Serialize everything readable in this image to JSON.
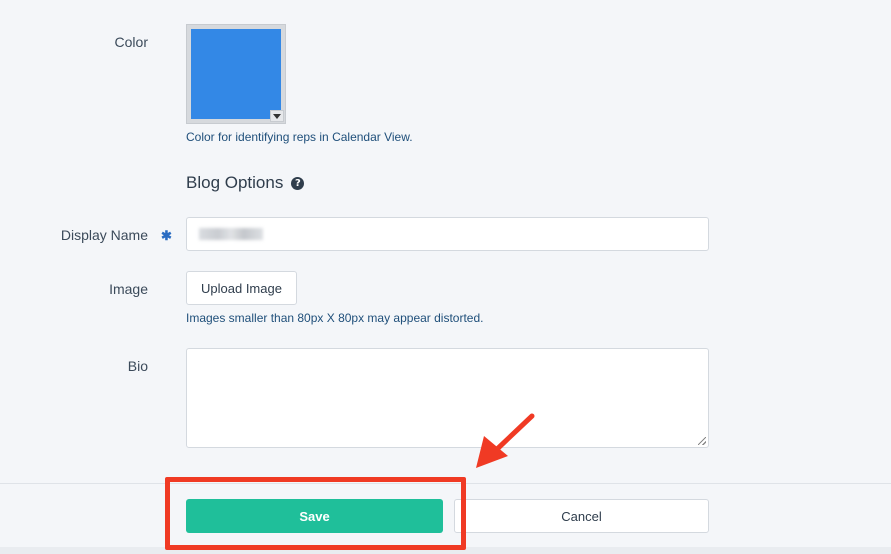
{
  "top_partial_text": "",
  "color_field": {
    "label": "Color",
    "value": "#3388e6",
    "help": "Color for identifying reps in Calendar View."
  },
  "blog_options": {
    "title": "Blog Options",
    "help_icon": "question-circle-icon"
  },
  "display_name": {
    "label": "Display Name",
    "required_mark": "✱",
    "value": ""
  },
  "image": {
    "label": "Image",
    "button_label": "Upload Image",
    "help": "Images smaller than 80px X 80px may appear distorted."
  },
  "bio": {
    "label": "Bio",
    "value": ""
  },
  "actions": {
    "save_label": "Save",
    "cancel_label": "Cancel"
  },
  "annotation": {
    "highlight_color": "#f03a24"
  },
  "colors": {
    "accent": "#1fbf9a",
    "link_text": "#1f4f7a"
  }
}
